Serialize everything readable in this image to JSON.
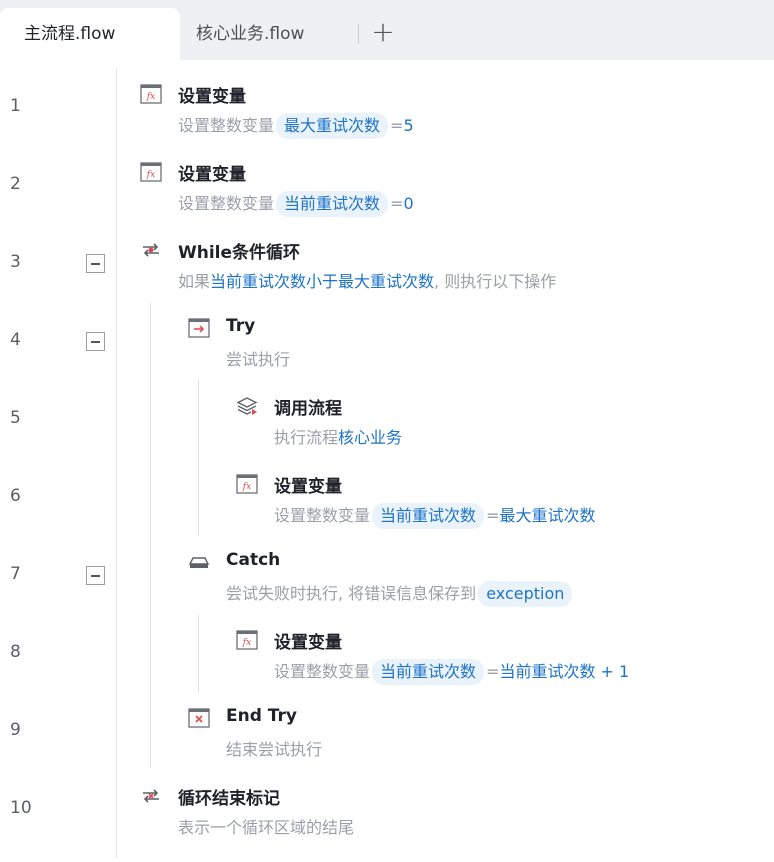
{
  "tabs": [
    {
      "label": "主流程.flow",
      "active": true
    },
    {
      "label": "核心业务.flow",
      "active": false
    }
  ],
  "add_tab_label": "+",
  "line_numbers": [
    "1",
    "2",
    "3",
    "4",
    "5",
    "6",
    "7",
    "8",
    "9",
    "10"
  ],
  "steps": {
    "s1": {
      "title": "设置变量",
      "prefix": "设置整数变量",
      "var": "最大重试次数",
      "eq": "=",
      "value": "5"
    },
    "s2": {
      "title": "设置变量",
      "prefix": "设置整数变量",
      "var": "当前重试次数",
      "eq": "=",
      "value": "0"
    },
    "s3": {
      "title": "While条件循环",
      "prefix": "如果",
      "cond": "当前重试次数小于最大重试次数",
      "suffix": ", 则执行以下操作"
    },
    "s4": {
      "title": "Try",
      "desc": "尝试执行"
    },
    "s5": {
      "title": "调用流程",
      "prefix": "执行流程",
      "target": "核心业务"
    },
    "s6": {
      "title": "设置变量",
      "prefix": "设置整数变量",
      "var": "当前重试次数",
      "eq": "=",
      "value": "最大重试次数"
    },
    "s7": {
      "title": "Catch",
      "prefix": "尝试失败时执行, 将错误信息保存到",
      "var": "exception"
    },
    "s8": {
      "title": "设置变量",
      "prefix": "设置整数变量",
      "var": "当前重试次数",
      "eq": "=",
      "value": "当前重试次数 + 1"
    },
    "s9": {
      "title": "End Try",
      "desc": "结束尝试执行"
    },
    "s10": {
      "title": "循环结束标记",
      "desc": "表示一个循环区域的结尾"
    }
  },
  "colors": {
    "link": "#1e73c8",
    "pill_bg": "#eaf3fb",
    "muted": "#9aa0a8",
    "icon_red": "#e0464b"
  }
}
